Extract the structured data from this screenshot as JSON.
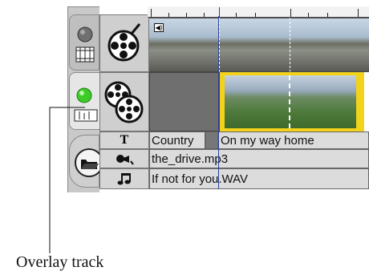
{
  "tracks": {
    "title_clips": [
      "Country",
      "On my way home"
    ],
    "sound_effect_clip": "the_drive.mp3",
    "music_clip": "If not for you.WAV"
  },
  "caption": "Overlay track",
  "icons": {
    "video_tab": "film-strip-camera-icon",
    "overlay_tab": "green-light-icon",
    "folder": "open-folder-icon",
    "video_track": "film-reel-icon",
    "overlay_track": "double-film-reel-icon",
    "title_track": "text-T-icon",
    "sound_track": "speaker-icon",
    "music_track": "music-note-icon",
    "audio_badge": "speaker-badge-icon"
  },
  "colors": {
    "panel_grey": "#c9c9c9",
    "status_green": "#3ecb2a",
    "trim_yellow": "#f3d21b"
  }
}
